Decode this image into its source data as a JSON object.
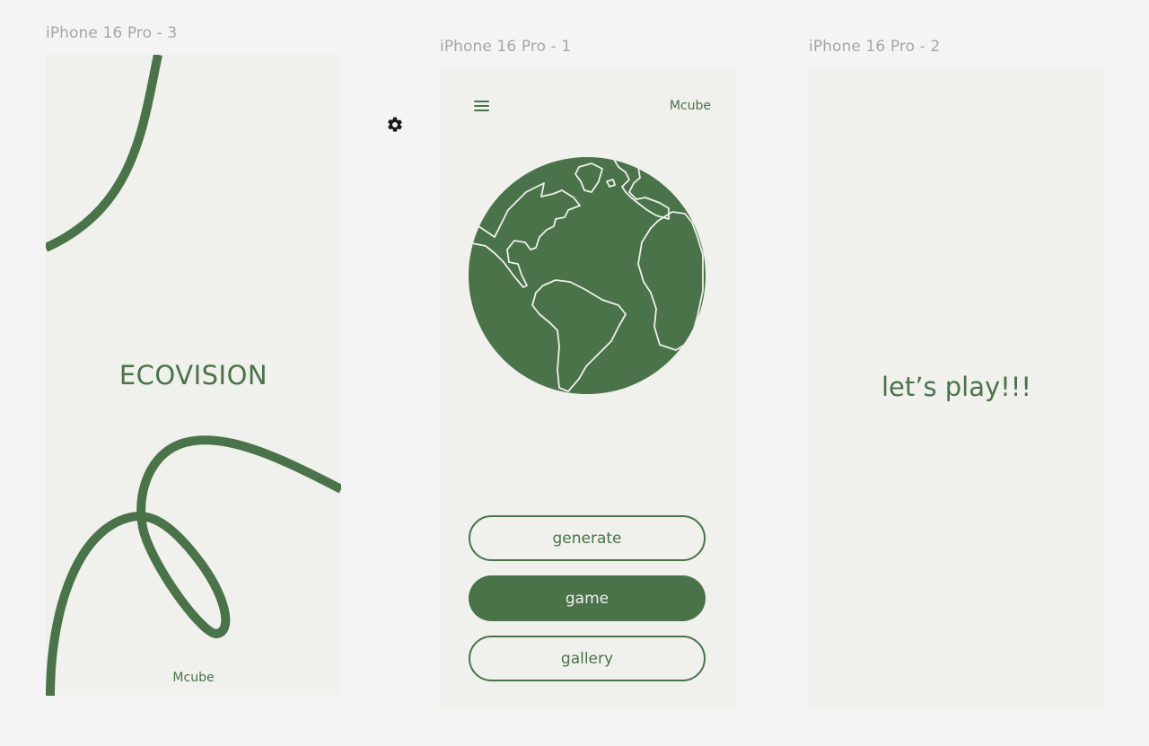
{
  "canvas": {
    "frames": [
      {
        "label": "iPhone 16 Pro - 3"
      },
      {
        "label": "iPhone 16 Pro - 1"
      },
      {
        "label": "iPhone 16 Pro - 2"
      }
    ],
    "settings_icon": "gear-icon"
  },
  "splash": {
    "title": "ECOVISION",
    "brand": "Mcube"
  },
  "home": {
    "menu_icon": "hamburger-menu-icon",
    "brand": "Mcube",
    "globe_icon": "globe-icon",
    "buttons": {
      "generate": "generate",
      "game": "game",
      "gallery": "gallery"
    }
  },
  "game_screen": {
    "title": "let’s play!!!"
  },
  "colors": {
    "accent": "#4a7349",
    "frame_bg": "#f0f0ec",
    "canvas_bg": "#f4f4f4",
    "label_gray": "#a6a6a6"
  }
}
